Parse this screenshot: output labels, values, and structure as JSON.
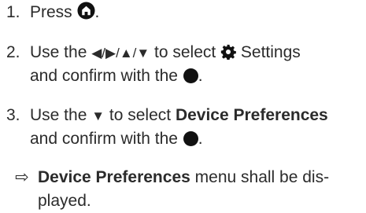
{
  "steps": [
    {
      "number": "1.",
      "text_before": "Press ",
      "icon": "home-icon",
      "text_after": "."
    },
    {
      "number": "2.",
      "text_before": "Use the ",
      "arrows": "◀/▶/▲/▼",
      "text_mid": " to select ",
      "icon": "gear-icon",
      "text_settings": " Settings",
      "line2_before": "and confirm with the ",
      "line2_icon": "ok-button-dot-icon",
      "line2_after": "."
    },
    {
      "number": "3.",
      "text_before": "Use the ",
      "arrow": "▼",
      "text_mid": " to select ",
      "bold": "Device Preferences",
      "line2_before": "and confirm with the ",
      "line2_icon": "ok-button-dot-icon",
      "line2_after": "."
    }
  ],
  "result": {
    "marker": "⇨",
    "bold": "Device Preferences",
    "text_after": " menu shall be dis-",
    "line2": "played."
  },
  "colors": {
    "text": "#2b2b2b",
    "icon": "#111111"
  }
}
